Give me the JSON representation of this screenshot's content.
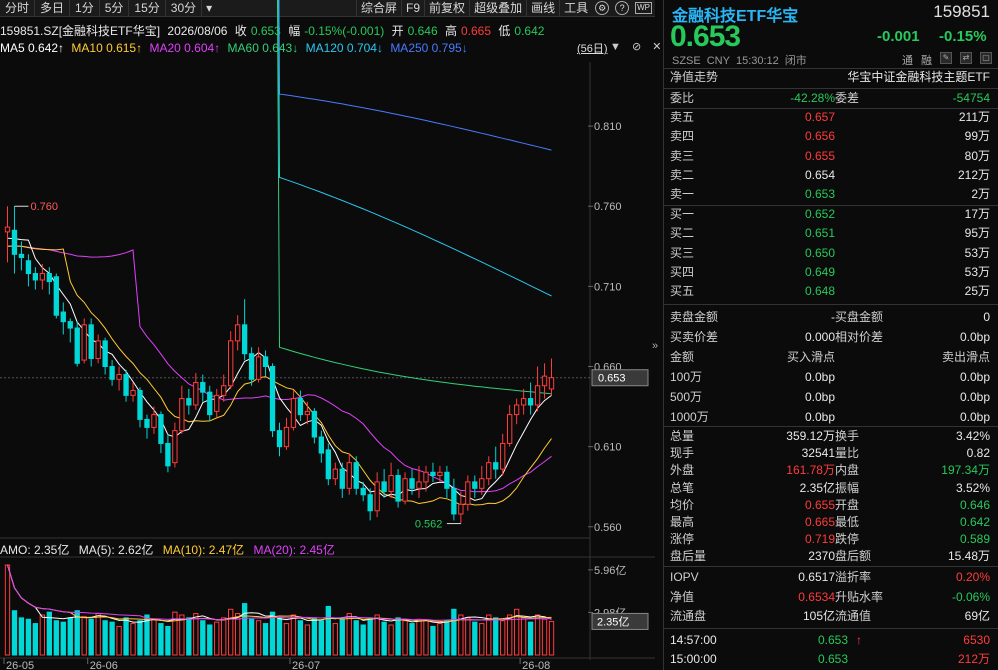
{
  "toolbar": {
    "tabs": [
      "分时",
      "多日",
      "1分",
      "5分",
      "15分",
      "30分",
      "▾"
    ],
    "tools": [
      "综合屏",
      "F9",
      "前复权",
      "超级叠加",
      "画线",
      "工具"
    ],
    "icon_gear": "⚙",
    "icon_help": "?",
    "icon_wp": "WP"
  },
  "info": {
    "title": "159851.SZ[金融科技ETF华宝]",
    "date": "2026/08/06",
    "close_label": "收",
    "close": "0.653",
    "chg_label": "幅",
    "chg": "-0.15%(-0.001)",
    "open_label": "开",
    "open": "0.646",
    "high_label": "高",
    "high": "0.665",
    "low_label": "低",
    "low": "0.642"
  },
  "ma": {
    "ma5": "MA5 0.642↑",
    "ma10": "MA10 0.615↑",
    "ma20": "MA20 0.604↑",
    "ma60": "MA60 0.643↓",
    "ma120": "MA120 0.704↓",
    "ma250": "MA250 0.795↓",
    "days_btn": "(56日)",
    "icons": "▼ ⊘ ✕"
  },
  "amo": {
    "amo": "AMO: 2.35亿",
    "ma5": "MA(5): 2.62亿",
    "ma10": "MA(10): 2.47亿",
    "ma20": "MA(20): 2.45亿"
  },
  "colors": {
    "up": "#ff3b3b",
    "down": "#00d7d7",
    "ma5": "#ffffff",
    "ma10": "#ffcc33",
    "ma20": "#e040fb",
    "ma60": "#31d07a",
    "ma120": "#29c8f0",
    "ma250": "#4a7bff"
  },
  "chart_data": {
    "type": "candlestick",
    "y_ticks": [
      "0.810",
      "0.760",
      "0.710",
      "0.660",
      "0.610",
      "0.560"
    ],
    "ylim": [
      0.553,
      0.85
    ],
    "x_ticks": [
      {
        "label": "26-05",
        "i": 0
      },
      {
        "label": "26-06",
        "i": 12
      },
      {
        "label": "26-07",
        "i": 41
      },
      {
        "label": "26-08",
        "i": 74
      }
    ],
    "current_price_label": "0.653",
    "current_price": 0.653,
    "hi_annotation": {
      "label": "0.760",
      "i": 1,
      "value": 0.76
    },
    "lo_annotation": {
      "label": "0.562",
      "i": 65,
      "value": 0.562
    },
    "candles": [
      [
        0.744,
        0.747,
        0.725,
        0.76
      ],
      [
        0.745,
        0.73,
        0.718,
        0.76
      ],
      [
        0.73,
        0.728,
        0.72,
        0.738
      ],
      [
        0.726,
        0.718,
        0.71,
        0.73
      ],
      [
        0.718,
        0.714,
        0.708,
        0.722
      ],
      [
        0.714,
        0.718,
        0.708,
        0.724
      ],
      [
        0.718,
        0.713,
        0.705,
        0.722
      ],
      [
        0.716,
        0.692,
        0.69,
        0.718
      ],
      [
        0.694,
        0.688,
        0.68,
        0.7
      ],
      [
        0.688,
        0.684,
        0.675,
        0.69
      ],
      [
        0.684,
        0.662,
        0.66,
        0.688
      ],
      [
        0.664,
        0.686,
        0.662,
        0.69
      ],
      [
        0.686,
        0.665,
        0.66,
        0.69
      ],
      [
        0.665,
        0.676,
        0.662,
        0.68
      ],
      [
        0.676,
        0.66,
        0.655,
        0.678
      ],
      [
        0.66,
        0.652,
        0.648,
        0.664
      ],
      [
        0.652,
        0.655,
        0.645,
        0.66
      ],
      [
        0.655,
        0.642,
        0.638,
        0.658
      ],
      [
        0.642,
        0.645,
        0.638,
        0.65
      ],
      [
        0.645,
        0.627,
        0.622,
        0.647
      ],
      [
        0.627,
        0.622,
        0.615,
        0.63
      ],
      [
        0.622,
        0.63,
        0.618,
        0.635
      ],
      [
        0.63,
        0.612,
        0.606,
        0.632
      ],
      [
        0.612,
        0.598,
        0.594,
        0.618
      ],
      [
        0.6,
        0.62,
        0.597,
        0.625
      ],
      [
        0.62,
        0.64,
        0.618,
        0.648
      ],
      [
        0.64,
        0.636,
        0.63,
        0.646
      ],
      [
        0.636,
        0.65,
        0.633,
        0.656
      ],
      [
        0.65,
        0.644,
        0.638,
        0.655
      ],
      [
        0.644,
        0.63,
        0.626,
        0.648
      ],
      [
        0.632,
        0.642,
        0.628,
        0.646
      ],
      [
        0.642,
        0.648,
        0.638,
        0.655
      ],
      [
        0.648,
        0.676,
        0.646,
        0.682
      ],
      [
        0.676,
        0.686,
        0.67,
        0.692
      ],
      [
        0.686,
        0.668,
        0.664,
        0.702
      ],
      [
        0.668,
        0.652,
        0.648,
        0.672
      ],
      [
        0.652,
        0.666,
        0.65,
        0.672
      ],
      [
        0.666,
        0.66,
        0.654,
        0.67
      ],
      [
        0.66,
        0.62,
        0.616,
        0.662
      ],
      [
        0.62,
        0.61,
        0.604,
        0.625
      ],
      [
        0.61,
        0.622,
        0.608,
        0.628
      ],
      [
        0.622,
        0.64,
        0.62,
        0.645
      ],
      [
        0.64,
        0.63,
        0.626,
        0.645
      ],
      [
        0.63,
        0.632,
        0.624,
        0.638
      ],
      [
        0.632,
        0.616,
        0.612,
        0.634
      ],
      [
        0.616,
        0.606,
        0.6,
        0.62
      ],
      [
        0.608,
        0.59,
        0.586,
        0.612
      ],
      [
        0.59,
        0.596,
        0.586,
        0.6
      ],
      [
        0.596,
        0.584,
        0.578,
        0.6
      ],
      [
        0.584,
        0.6,
        0.58,
        0.606
      ],
      [
        0.6,
        0.584,
        0.58,
        0.604
      ],
      [
        0.584,
        0.58,
        0.576,
        0.588
      ],
      [
        0.58,
        0.57,
        0.564,
        0.584
      ],
      [
        0.57,
        0.588,
        0.566,
        0.594
      ],
      [
        0.588,
        0.582,
        0.578,
        0.596
      ],
      [
        0.582,
        0.592,
        0.578,
        0.6
      ],
      [
        0.592,
        0.576,
        0.572,
        0.596
      ],
      [
        0.576,
        0.59,
        0.574,
        0.594
      ],
      [
        0.59,
        0.584,
        0.58,
        0.596
      ],
      [
        0.584,
        0.588,
        0.578,
        0.598
      ],
      [
        0.588,
        0.594,
        0.582,
        0.598
      ],
      [
        0.594,
        0.592,
        0.588,
        0.6
      ],
      [
        0.592,
        0.594,
        0.588,
        0.598
      ],
      [
        0.594,
        0.584,
        0.578,
        0.598
      ],
      [
        0.584,
        0.568,
        0.564,
        0.59
      ],
      [
        0.568,
        0.574,
        0.562,
        0.582
      ],
      [
        0.574,
        0.588,
        0.57,
        0.592
      ],
      [
        0.588,
        0.584,
        0.578,
        0.592
      ],
      [
        0.584,
        0.59,
        0.58,
        0.598
      ],
      [
        0.59,
        0.6,
        0.586,
        0.604
      ],
      [
        0.6,
        0.596,
        0.59,
        0.61
      ],
      [
        0.596,
        0.612,
        0.592,
        0.618
      ],
      [
        0.612,
        0.63,
        0.61,
        0.636
      ],
      [
        0.63,
        0.636,
        0.624,
        0.64
      ],
      [
        0.636,
        0.64,
        0.63,
        0.646
      ],
      [
        0.64,
        0.636,
        0.63,
        0.65
      ],
      [
        0.636,
        0.648,
        0.632,
        0.66
      ],
      [
        0.648,
        0.654,
        0.64,
        0.662
      ],
      [
        0.646,
        0.653,
        0.642,
        0.665
      ]
    ],
    "ma5_end": 0.642,
    "ma10_end": 0.615,
    "ma20_end": 0.604,
    "ma60_end": 0.643,
    "ma120_end": 0.704,
    "ma250_end": 0.795,
    "vol_ticks": [
      "5.96亿",
      "2.98亿"
    ],
    "vol_label": "2.35亿",
    "volume_ylim": [
      0,
      6.3
    ],
    "volumes": [
      6.3,
      3.1,
      2.6,
      2.5,
      2.2,
      2.8,
      3.0,
      2.4,
      2.3,
      2.6,
      3.1,
      2.7,
      2.5,
      2.9,
      2.4,
      2.3,
      2.0,
      2.6,
      2.2,
      2.4,
      2.8,
      2.5,
      2.2,
      2.0,
      3.0,
      2.8,
      2.6,
      2.9,
      2.4,
      2.1,
      2.3,
      2.6,
      3.2,
      2.9,
      3.6,
      2.5,
      2.4,
      2.2,
      3.0,
      2.6,
      2.2,
      2.8,
      2.4,
      2.1,
      2.6,
      2.4,
      3.4,
      2.2,
      2.5,
      2.9,
      2.4,
      2.1,
      2.6,
      2.8,
      2.3,
      2.1,
      2.6,
      2.4,
      2.2,
      2.5,
      2.4,
      2.0,
      2.2,
      2.4,
      3.2,
      2.8,
      2.6,
      2.3,
      2.2,
      2.8,
      2.6,
      2.4,
      2.8,
      3.2,
      2.6,
      2.3,
      2.8,
      2.5,
      2.35
    ]
  },
  "panel": {
    "name": "金融科技ETF华宝",
    "code": "159851",
    "price": "0.653",
    "chg": "-0.001",
    "pct": "-0.15%",
    "meta": [
      "SZSE",
      "CNY",
      "15:30:12",
      "闭市"
    ],
    "icons": [
      "通",
      "融",
      "✎",
      "⇄",
      "▢"
    ],
    "nav_label": "净值走势",
    "nav_name": "华宝中证金融科技主题ETF",
    "weibi_label": "委比",
    "weibi": "-42.28%",
    "weicha_label": "委差",
    "weicha": "-54754",
    "asks": [
      {
        "label": "卖五",
        "price": "0.657",
        "vol": "211万"
      },
      {
        "label": "卖四",
        "price": "0.656",
        "vol": "99万"
      },
      {
        "label": "卖三",
        "price": "0.655",
        "vol": "80万"
      },
      {
        "label": "卖二",
        "price": "0.654",
        "vol": "212万"
      },
      {
        "label": "卖一",
        "price": "0.653",
        "vol": "2万"
      }
    ],
    "bids": [
      {
        "label": "买一",
        "price": "0.652",
        "vol": "17万"
      },
      {
        "label": "买二",
        "price": "0.651",
        "vol": "95万"
      },
      {
        "label": "买三",
        "price": "0.650",
        "vol": "53万"
      },
      {
        "label": "买四",
        "price": "0.649",
        "vol": "53万"
      },
      {
        "label": "买五",
        "price": "0.648",
        "vol": "25万"
      }
    ],
    "misc": [
      {
        "l1": "卖盘金额",
        "v1": "-",
        "l2": "买盘金额",
        "v2": "0"
      },
      {
        "l1": "买卖价差",
        "v1": "0.000",
        "l2": "相对价差",
        "v2": "0.0bp"
      }
    ],
    "slip_head": {
      "l1": "金额",
      "v1": "买入滑点",
      "v2": "卖出滑点"
    },
    "slip": [
      {
        "l1": "100万",
        "v1": "0.0bp",
        "v2": "0.0bp"
      },
      {
        "l1": "500万",
        "v1": "0.0bp",
        "v2": "0.0bp"
      },
      {
        "l1": "1000万",
        "v1": "0.0bp",
        "v2": "0.0bp"
      }
    ],
    "stats": [
      {
        "l1": "总量",
        "v1": "359.12万",
        "c1": "white",
        "l2": "换手",
        "v2": "3.42%",
        "c2": "white"
      },
      {
        "l1": "现手",
        "v1": "32541",
        "c1": "white",
        "l2": "量比",
        "v2": "0.82",
        "c2": "white"
      },
      {
        "l1": "外盘",
        "v1": "161.78万",
        "c1": "red",
        "l2": "内盘",
        "v2": "197.34万",
        "c2": "green"
      },
      {
        "l1": "总笔",
        "v1": "2.35亿",
        "c1": "white",
        "l2": "振幅",
        "v2": "3.52%",
        "c2": "white"
      },
      {
        "l1": "均价",
        "v1": "0.655",
        "c1": "red",
        "l2": "开盘",
        "v2": "0.646",
        "c2": "green"
      },
      {
        "l1": "最高",
        "v1": "0.665",
        "c1": "red",
        "l2": "最低",
        "v2": "0.642",
        "c2": "green"
      },
      {
        "l1": "涨停",
        "v1": "0.719",
        "c1": "red",
        "l2": "跌停",
        "v2": "0.589",
        "c2": "green"
      },
      {
        "l1": "盘后量",
        "v1": "2370",
        "c1": "white",
        "l2": "盘后额",
        "v2": "15.48万",
        "c2": "white"
      }
    ],
    "iopv": [
      {
        "l1": "IOPV",
        "v1": "0.6517",
        "c1": "white",
        "l2": "溢折率",
        "v2": "0.20%",
        "c2": "red"
      },
      {
        "l1": "净值",
        "v1": "0.6534",
        "c1": "red",
        "l2": "升贴水率",
        "v2": "-0.06%",
        "c2": "green"
      },
      {
        "l1": "流通盘",
        "v1": "105亿",
        "c1": "white",
        "l2": "流通值",
        "v2": "69亿",
        "c2": "white"
      }
    ],
    "ticks": [
      {
        "time": "14:57:00",
        "price": "0.653",
        "arrow": "↑",
        "vol": "6530"
      },
      {
        "time": "15:00:00",
        "price": "0.653",
        "arrow": "",
        "vol": "212万"
      }
    ]
  }
}
